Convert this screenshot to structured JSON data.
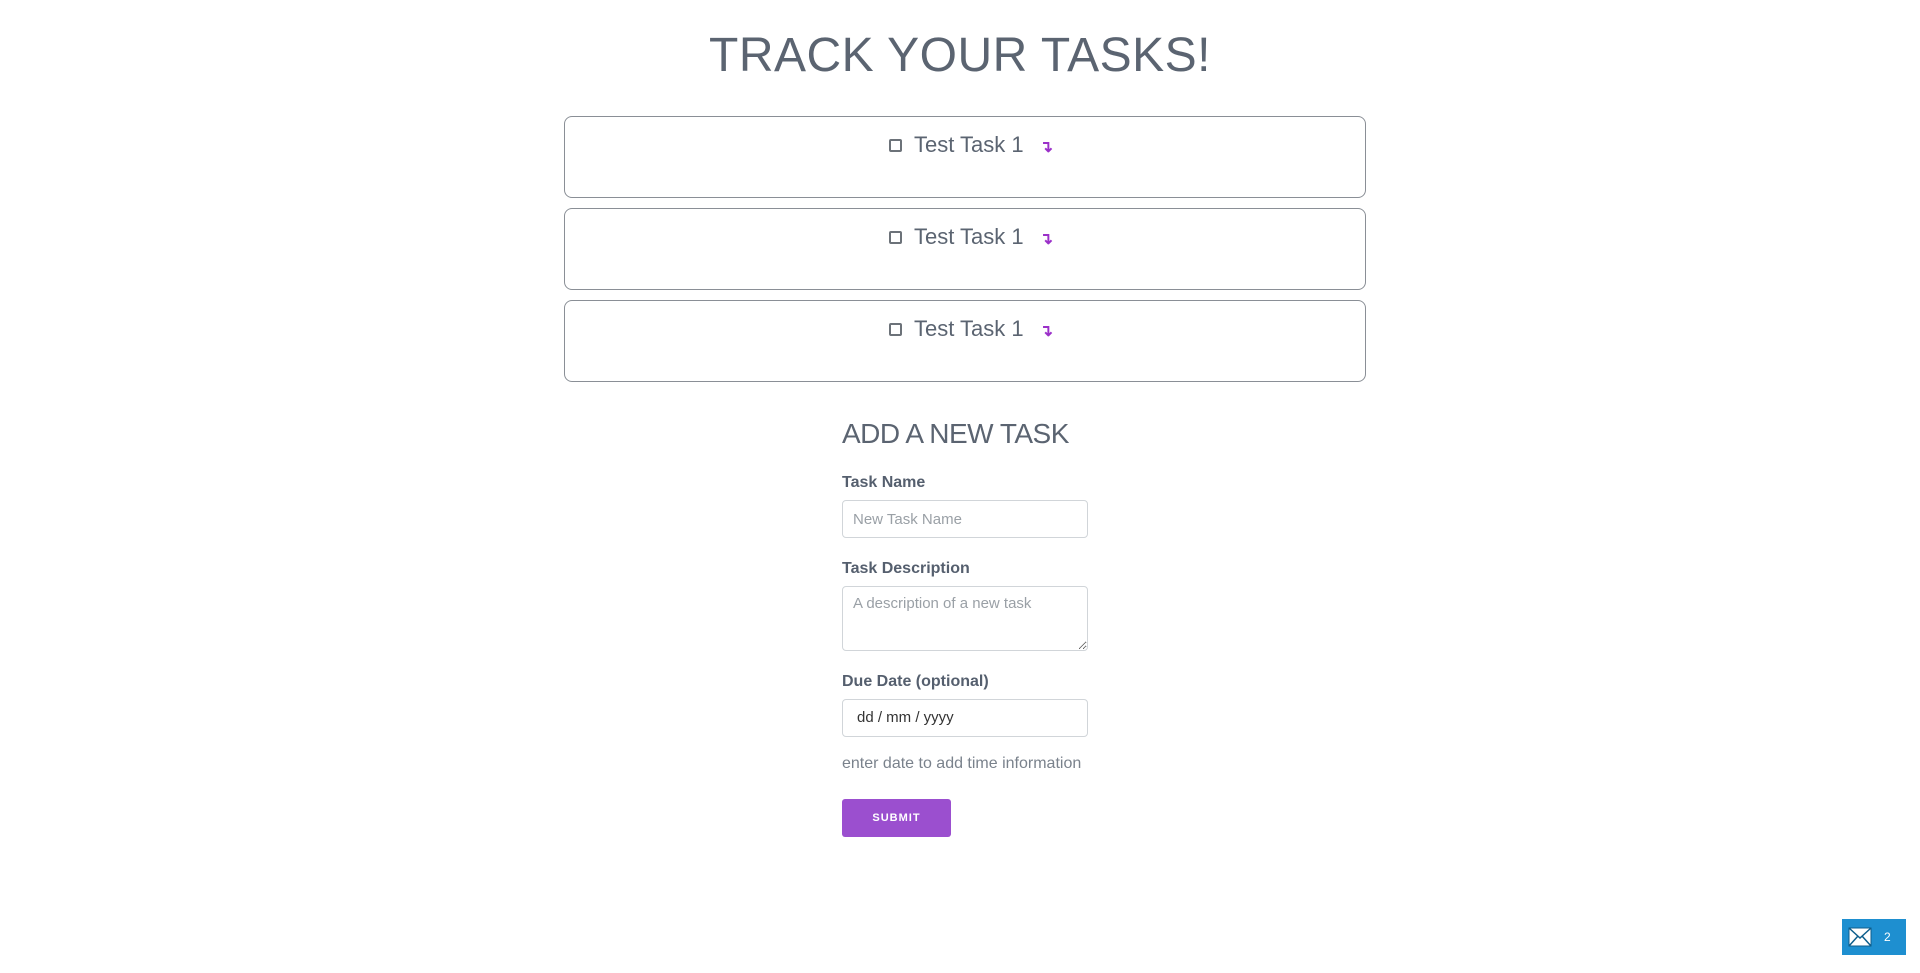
{
  "header": {
    "title": "TRACK YOUR TASKS!"
  },
  "tasks": [
    {
      "title": "Test Task 1",
      "expand_glyph": "↴"
    },
    {
      "title": "Test Task 1",
      "expand_glyph": "↴"
    },
    {
      "title": "Test Task 1",
      "expand_glyph": "↴"
    }
  ],
  "form": {
    "heading": "ADD A NEW TASK",
    "task_name_label": "Task Name",
    "task_name_placeholder": "New Task Name",
    "task_description_label": "Task Description",
    "task_description_placeholder": "A description of a new task",
    "due_date_label": "Due Date (optional)",
    "due_date_placeholder": "dd / mm / yyyy",
    "hint": "enter date to add time information",
    "submit_label": "SUBMIT"
  },
  "corner_widget": {
    "icon": "envelope-icon",
    "count": "2"
  },
  "colors": {
    "accent": "#9b4fcf",
    "widget": "#1e8fd0",
    "text": "#5b6471"
  }
}
